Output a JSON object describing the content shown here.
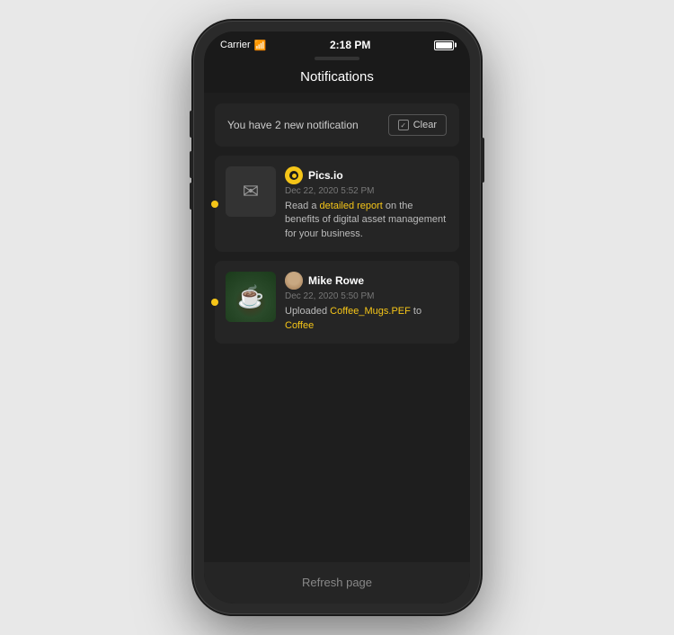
{
  "status_bar": {
    "carrier": "Carrier",
    "time": "2:18 PM"
  },
  "nav": {
    "title": "Notifications"
  },
  "clear_section": {
    "message": "You have 2 new notification",
    "button_label": "Clear"
  },
  "notifications": [
    {
      "id": "notif-1",
      "sender": "Pics.io",
      "time": "Dec 22, 2020 5:52 PM",
      "message_before": "Read a ",
      "message_link": "detailed report",
      "message_after": " on the benefits of digital asset management for your business.",
      "has_unread": true,
      "type": "email"
    },
    {
      "id": "notif-2",
      "sender": "Mike Rowe",
      "time": "Dec 22, 2020 5:50 PM",
      "message_before": "Uploaded ",
      "message_link1": "Coffee_Mugs.PEF",
      "message_middle": " to ",
      "message_link2": "Coffee",
      "has_unread": true,
      "type": "image"
    }
  ],
  "bottom": {
    "refresh_label": "Refresh page"
  },
  "colors": {
    "accent": "#f5c518",
    "background": "#1a1a1a",
    "card": "#252525",
    "text_primary": "#ffffff",
    "text_secondary": "#bbbbbb",
    "text_muted": "#777777"
  }
}
